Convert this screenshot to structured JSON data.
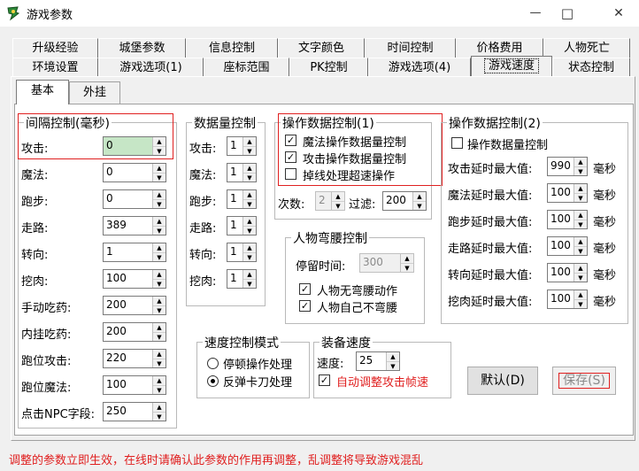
{
  "window": {
    "title": "游戏参数",
    "minimize": "—",
    "maximize": "□",
    "close": "✕"
  },
  "tabs_row1": [
    "升级经验",
    "城堡参数",
    "信息控制",
    "文字颜色",
    "时间控制",
    "价格费用",
    "人物死亡"
  ],
  "tabs_row2": [
    "环境设置",
    "游戏选项(1)",
    "座标范围",
    "PK控制",
    "游戏选项(4)",
    "游戏速度",
    "状态控制"
  ],
  "subtabs": [
    "基本",
    "外挂"
  ],
  "interval": {
    "title": "间隔控制(毫秒)",
    "rows": [
      {
        "label": "攻击:",
        "value": "0"
      },
      {
        "label": "魔法:",
        "value": "0"
      },
      {
        "label": "跑步:",
        "value": "0"
      },
      {
        "label": "走路:",
        "value": "389"
      },
      {
        "label": "转向:",
        "value": "1"
      },
      {
        "label": "挖肉:",
        "value": "100"
      },
      {
        "label": "手动吃药:",
        "value": "200"
      },
      {
        "label": "内挂吃药:",
        "value": "200"
      },
      {
        "label": "跑位攻击:",
        "value": "220"
      },
      {
        "label": "跑位魔法:",
        "value": "100"
      },
      {
        "label": "点击NPC字段:",
        "value": "250"
      }
    ]
  },
  "count": {
    "title": "数据量控制",
    "rows": [
      {
        "label": "攻击:",
        "value": "1"
      },
      {
        "label": "魔法:",
        "value": "1"
      },
      {
        "label": "跑步:",
        "value": "1"
      },
      {
        "label": "走路:",
        "value": "1"
      },
      {
        "label": "转向:",
        "value": "1"
      },
      {
        "label": "挖肉:",
        "value": "1"
      }
    ]
  },
  "op1": {
    "title": "操作数据控制(1)",
    "checks": [
      {
        "label": "魔法操作数据量控制",
        "mark": "✓"
      },
      {
        "label": "攻击操作数据量控制",
        "mark": "✓"
      },
      {
        "label": "掉线处理超速操作",
        "mark": ""
      }
    ],
    "times_label": "次数:",
    "times_value": "2",
    "filter_label": "过滤:",
    "filter_value": "200"
  },
  "bend": {
    "title": "人物弯腰控制",
    "stay_label": "停留时间:",
    "stay_value": "300",
    "checks": [
      {
        "label": "人物无弯腰动作",
        "mark": "✓"
      },
      {
        "label": "人物自己不弯腰",
        "mark": "✓"
      }
    ]
  },
  "op2": {
    "title": "操作数据控制(2)",
    "check_label": "操作数据量控制",
    "check_mark": "",
    "unit": "毫秒",
    "rows": [
      {
        "label": "攻击延时最大值:",
        "value": "990"
      },
      {
        "label": "魔法延时最大值:",
        "value": "100"
      },
      {
        "label": "跑步延时最大值:",
        "value": "100"
      },
      {
        "label": "走路延时最大值:",
        "value": "100"
      },
      {
        "label": "转向延时最大值:",
        "value": "100"
      },
      {
        "label": "挖肉延时最大值:",
        "value": "100"
      }
    ]
  },
  "speed_mode": {
    "title": "速度控制模式",
    "options": [
      {
        "label": "停顿操作处理",
        "selected": false
      },
      {
        "label": "反弹卡刀处理",
        "selected": true
      }
    ]
  },
  "equip_speed": {
    "title": "装备速度",
    "speed_label": "速度:",
    "speed_value": "25",
    "auto_label": "自动调整攻击帧速",
    "auto_mark": "✓"
  },
  "buttons": {
    "default": "默认(D)",
    "save": "保存(S)"
  },
  "status": "调整的参数立即生效，在线时请确认此参数的作用再调整，乱调整将导致游戏混乱",
  "colors": {
    "status_red": "#e02020",
    "spin_green": "#c6e6c6"
  }
}
